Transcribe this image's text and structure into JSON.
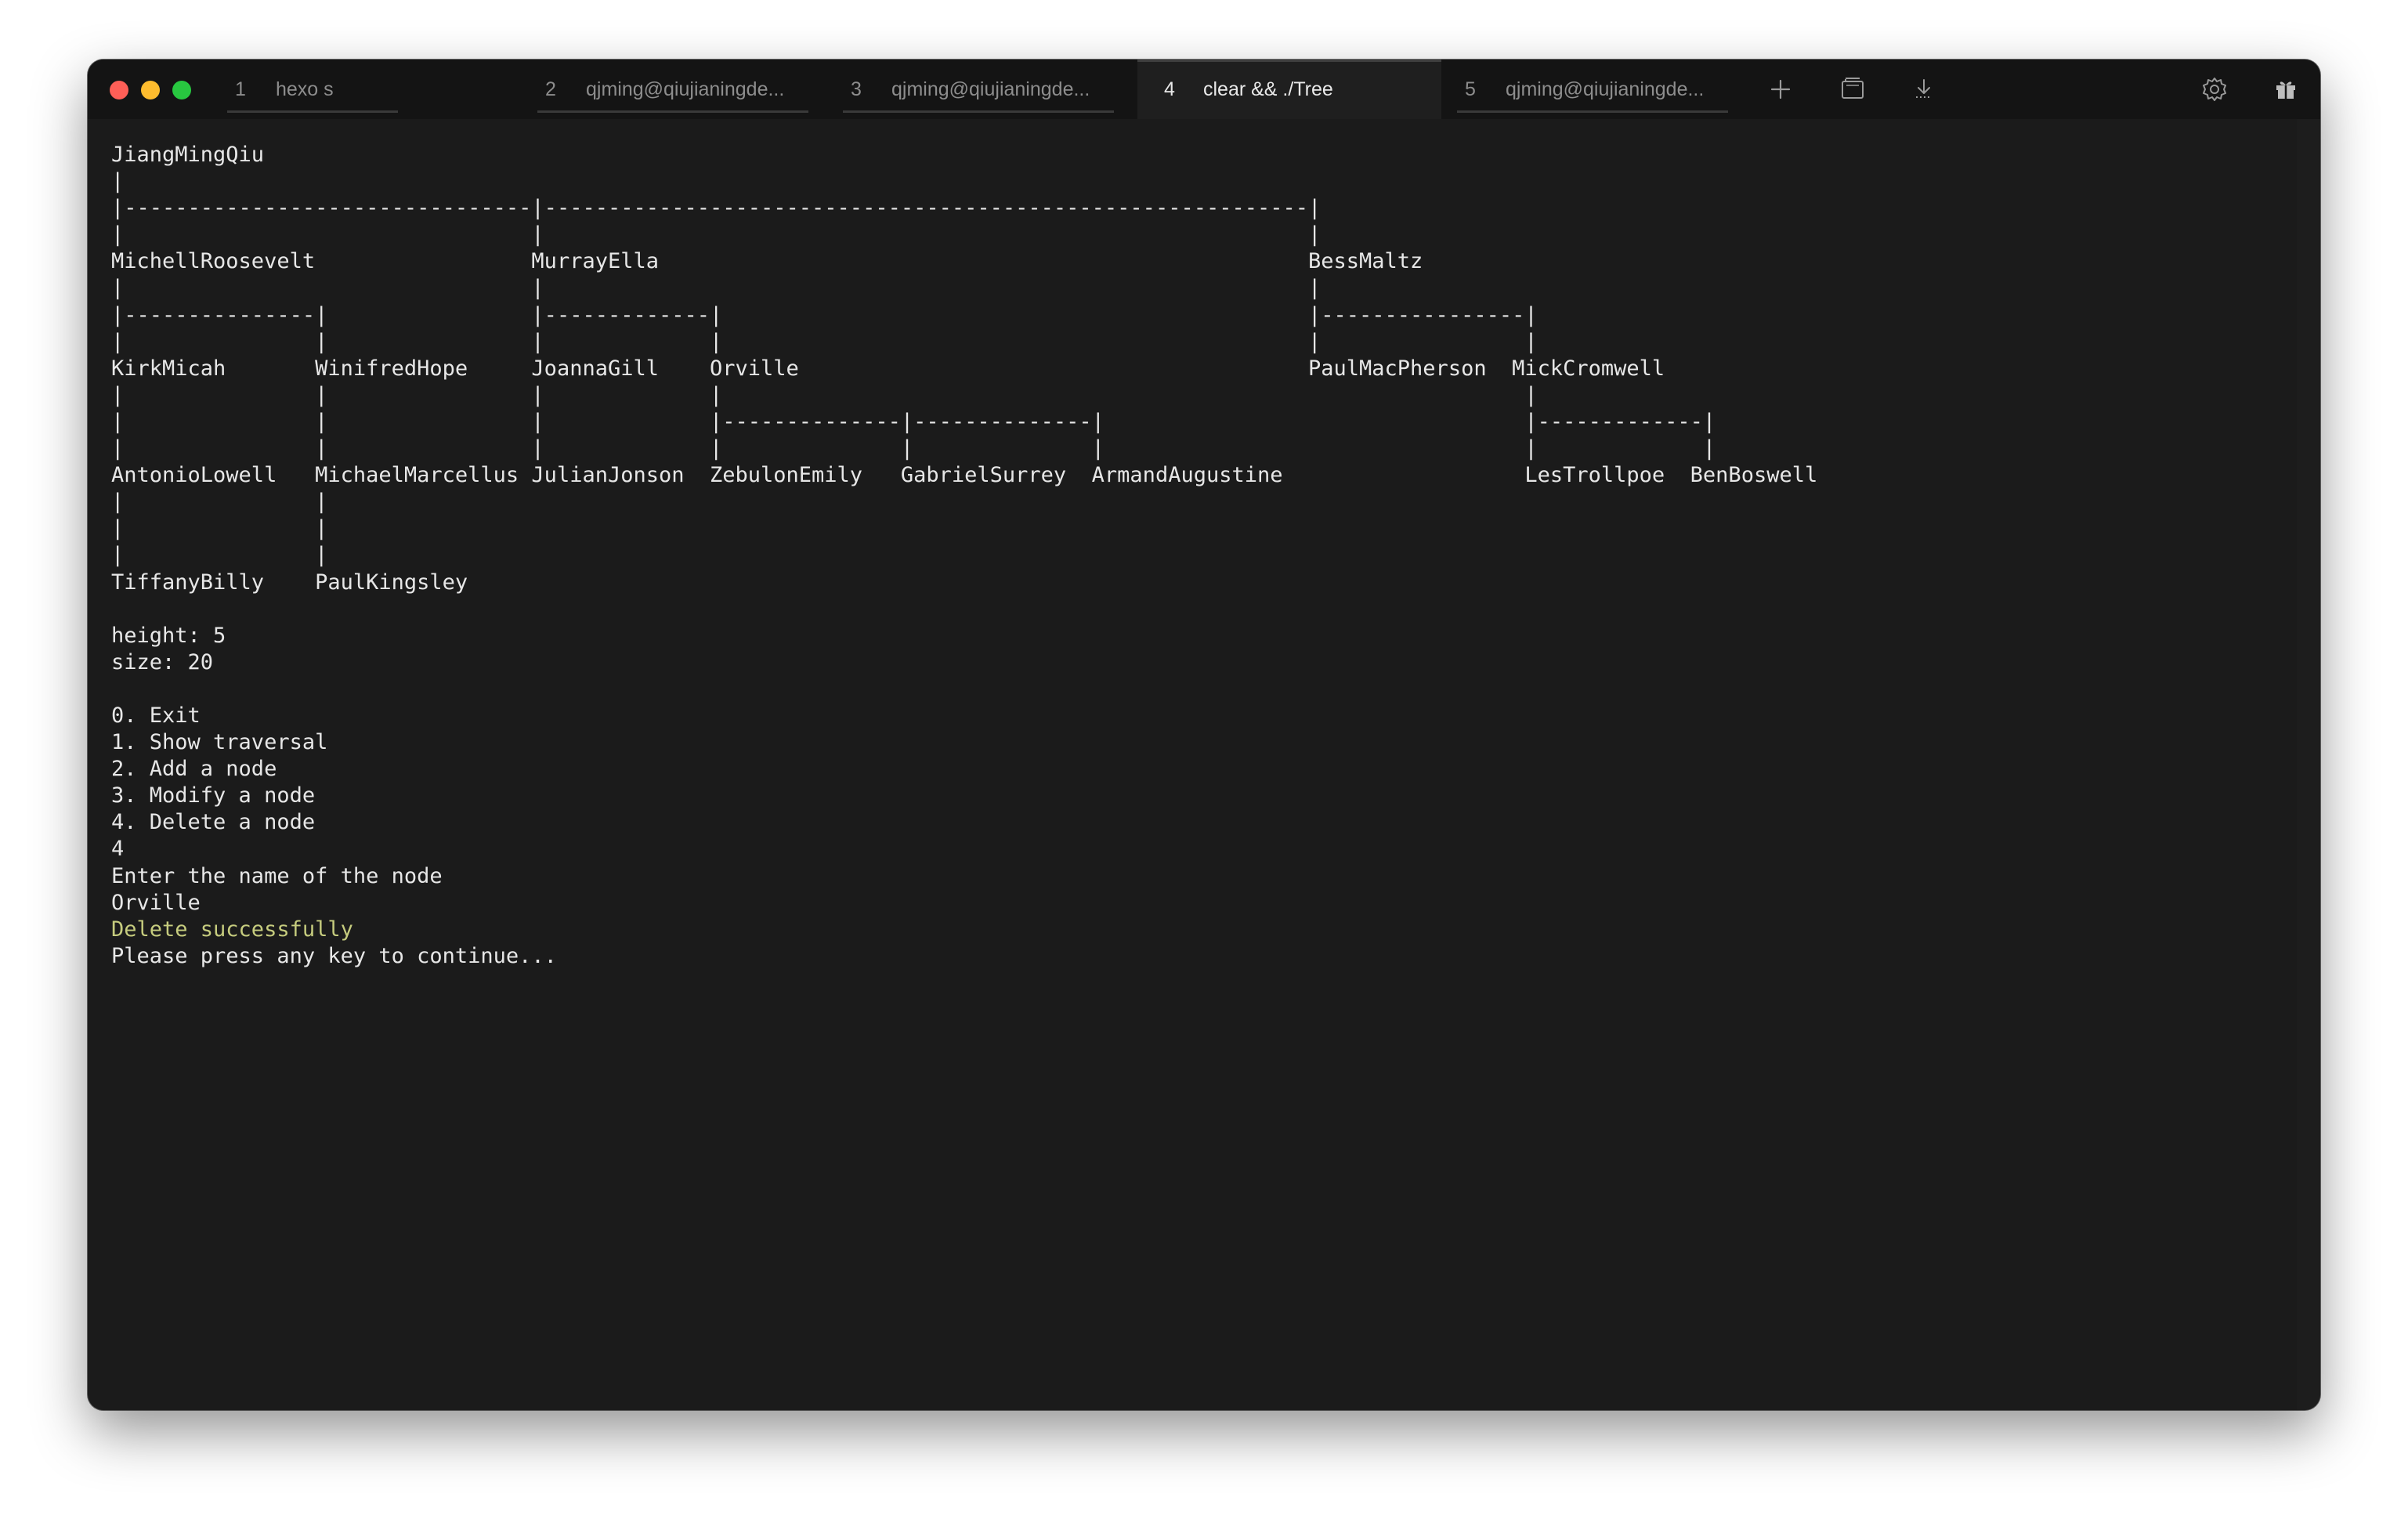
{
  "window": {
    "traffic_lights": {
      "close_color": "#ff5f57",
      "minimize_color": "#febc2e",
      "zoom_color": "#28c840"
    }
  },
  "tabs": [
    {
      "number": "1",
      "title": "hexo s",
      "active": false
    },
    {
      "number": "2",
      "title": "qjming@qiujianingde...",
      "active": false
    },
    {
      "number": "3",
      "title": "qjming@qiujianingde...",
      "active": false
    },
    {
      "number": "4",
      "title": "clear && ./Tree",
      "active": true
    },
    {
      "number": "5",
      "title": "qjming@qiujianingde...",
      "active": false
    }
  ],
  "toolbar": {
    "icons": [
      "plus-icon",
      "split-pane-icon",
      "download-icon",
      "gear-icon",
      "gift-icon"
    ]
  },
  "terminal": {
    "lines": [
      "JiangMingQiu",
      "|",
      "|--------------------------------|------------------------------------------------------------|",
      "|                                |                                                            |",
      "MichellRoosevelt                 MurrayElla                                                   BessMaltz",
      "|                                |                                                            |",
      "|---------------|                |-------------|                                              |----------------|",
      "|               |                |             |                                              |                |",
      "KirkMicah       WinifredHope     JoannaGill    Orville                                        PaulMacPherson  MickCromwell",
      "|               |                |             |                                                               |",
      "|               |                |             |--------------|--------------|                                 |-------------|",
      "|               |                |             |              |              |                                 |             |",
      "AntonioLowell   MichaelMarcellus JulianJonson  ZebulonEmily   GabrielSurrey  ArmandAugustine                   LesTrollpoe  BenBoswell",
      "|               |",
      "|               |",
      "|               |",
      "TiffanyBilly    PaulKingsley",
      "",
      "height: 5",
      "size: 20",
      "",
      "0. Exit",
      "1. Show traversal",
      "2. Add a node",
      "3. Modify a node",
      "4. Delete a node",
      "4",
      "Enter the name of the node",
      "Orville"
    ],
    "success_message": "Delete successfully",
    "prompt": "Please press any key to continue...",
    "success_color": "#c6cc7e"
  }
}
